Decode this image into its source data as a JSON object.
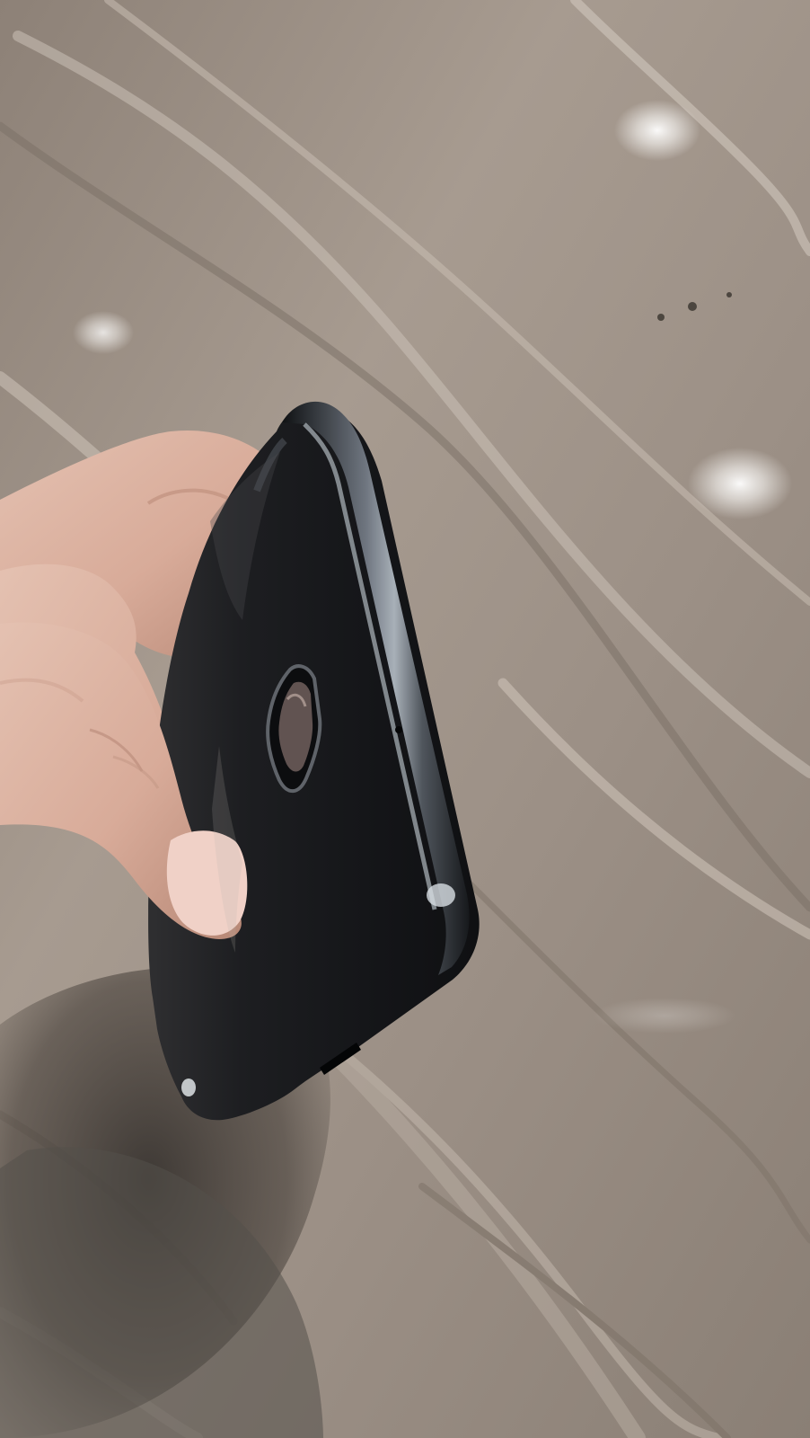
{
  "scene": {
    "subject": "black-smartphone-back-view",
    "background": "wooden-floor",
    "palette": {
      "floor_light": "#b8ada2",
      "floor_mid": "#948a80",
      "floor_dark": "#6f665d",
      "phone_body": "#151618",
      "phone_edge": "#2a2d31",
      "phone_highlight": "#a9afb6",
      "skin": "#dcb4a4",
      "skin_shadow": "#b98d7c",
      "fingernail": "#efd0c6",
      "shadow": "#3b3632"
    }
  }
}
